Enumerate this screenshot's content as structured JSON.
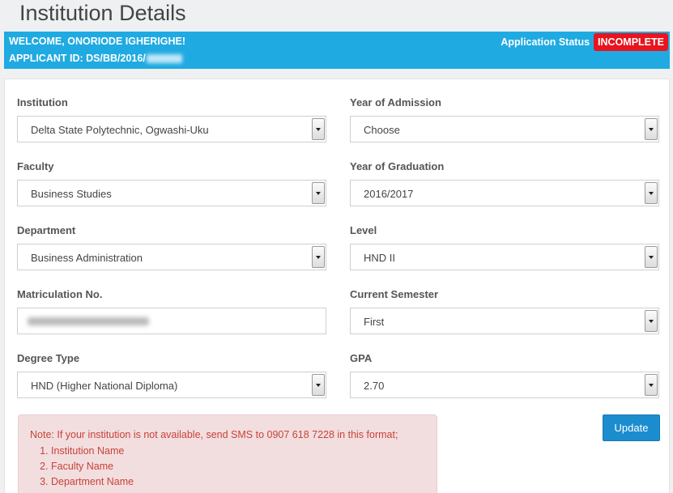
{
  "page": {
    "title": "Institution Details"
  },
  "banner": {
    "welcome": "WELCOME, ONORIODE IGHERIGHE!",
    "applicant_id_prefix": "APPLICANT ID: DS/BB/2016/",
    "status_label": "Application Status",
    "status_value": "INCOMPLETE",
    "status_color": "#e8141e",
    "bg_color": "#20aae2"
  },
  "form": {
    "institution": {
      "label": "Institution",
      "value": "Delta State Polytechnic, Ogwashi-Uku"
    },
    "year_of_admission": {
      "label": "Year of Admission",
      "value": "Choose"
    },
    "faculty": {
      "label": "Faculty",
      "value": "Business Studies"
    },
    "year_of_graduation": {
      "label": "Year of Graduation",
      "value": "2016/2017"
    },
    "department": {
      "label": "Department",
      "value": "Business Administration"
    },
    "level": {
      "label": "Level",
      "value": "HND II"
    },
    "matriculation_no": {
      "label": "Matriculation No.",
      "value": ""
    },
    "current_semester": {
      "label": "Current Semester",
      "value": "First"
    },
    "degree_type": {
      "label": "Degree Type",
      "value": "HND (Higher National Diploma)"
    },
    "gpa": {
      "label": "GPA",
      "value": "2.70"
    }
  },
  "note": {
    "text": "Note: If your institution is not available, send SMS to 0907 618 7228 in this format;",
    "items": [
      "Institution Name",
      "Faculty Name",
      "Department Name"
    ]
  },
  "actions": {
    "update_label": "Update"
  }
}
